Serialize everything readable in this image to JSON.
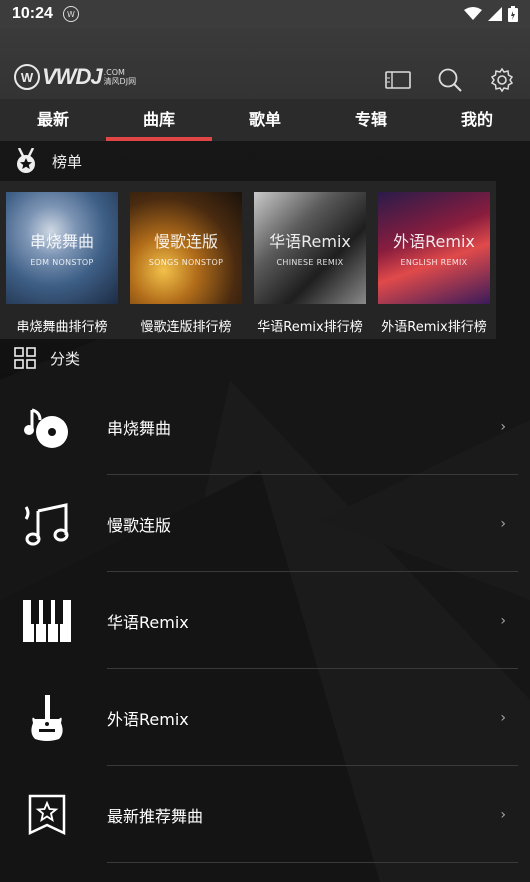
{
  "status_bar": {
    "time": "10:24",
    "app_icon": "W",
    "icons": [
      "wifi-icon",
      "signal-icon",
      "battery-icon"
    ]
  },
  "header": {
    "logo": {
      "mark": "W",
      "wordmark": "VWDJ",
      "tld": ".COM",
      "tagline": "清风DJ网"
    },
    "icons": [
      "cast-icon",
      "search-icon",
      "settings-icon"
    ]
  },
  "tabs": [
    {
      "label": "最新",
      "active": false
    },
    {
      "label": "曲库",
      "active": true
    },
    {
      "label": "歌单",
      "active": false
    },
    {
      "label": "专辑",
      "active": false
    },
    {
      "label": "我的",
      "active": false
    }
  ],
  "ranking": {
    "title": "榜单",
    "cards": [
      {
        "big": "串烧舞曲",
        "small": "EDM NONSTOP",
        "caption": "串烧舞曲排行榜"
      },
      {
        "big": "慢歌连版",
        "small": "SONGS NONSTOP",
        "caption": "慢歌连版排行榜"
      },
      {
        "big": "华语Remix",
        "small": "CHINESE REMIX",
        "caption": "华语Remix排行榜"
      },
      {
        "big": "外语Remix",
        "small": "ENGLISH REMIX",
        "caption": "外语Remix排行榜"
      }
    ]
  },
  "category": {
    "title": "分类",
    "items": [
      {
        "label": "串烧舞曲",
        "icon": "music-disc-icon"
      },
      {
        "label": "慢歌连版",
        "icon": "music-notes-icon"
      },
      {
        "label": "华语Remix",
        "icon": "piano-icon"
      },
      {
        "label": "外语Remix",
        "icon": "guitar-icon"
      },
      {
        "label": "最新推荐舞曲",
        "icon": "star-bookmark-icon"
      }
    ],
    "chevron": "›"
  },
  "colors": {
    "accent": "#e04646",
    "tab_bar": "#2b2b2b",
    "header": "#363636"
  }
}
